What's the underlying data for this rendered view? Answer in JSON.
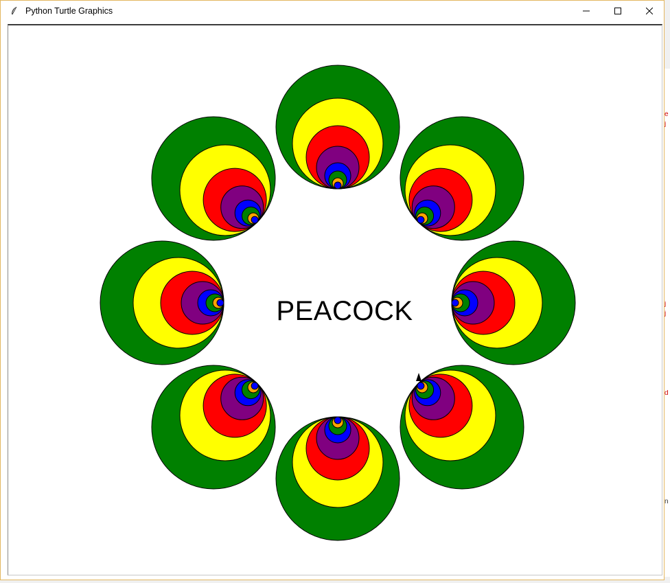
{
  "window": {
    "title": "Python Turtle Graphics",
    "controls": [
      "minimize-icon",
      "maximize-icon",
      "close-icon"
    ]
  },
  "canvas": {
    "text": "PEACOCK",
    "background": "#ffffff",
    "feather_count": 8,
    "ring_colors": [
      "#008000",
      "#ffff00",
      "#ff0000",
      "#800080",
      "#0000ff",
      "#008000",
      "#ffa500",
      "#0000ff"
    ],
    "outline_color": "#000000"
  }
}
